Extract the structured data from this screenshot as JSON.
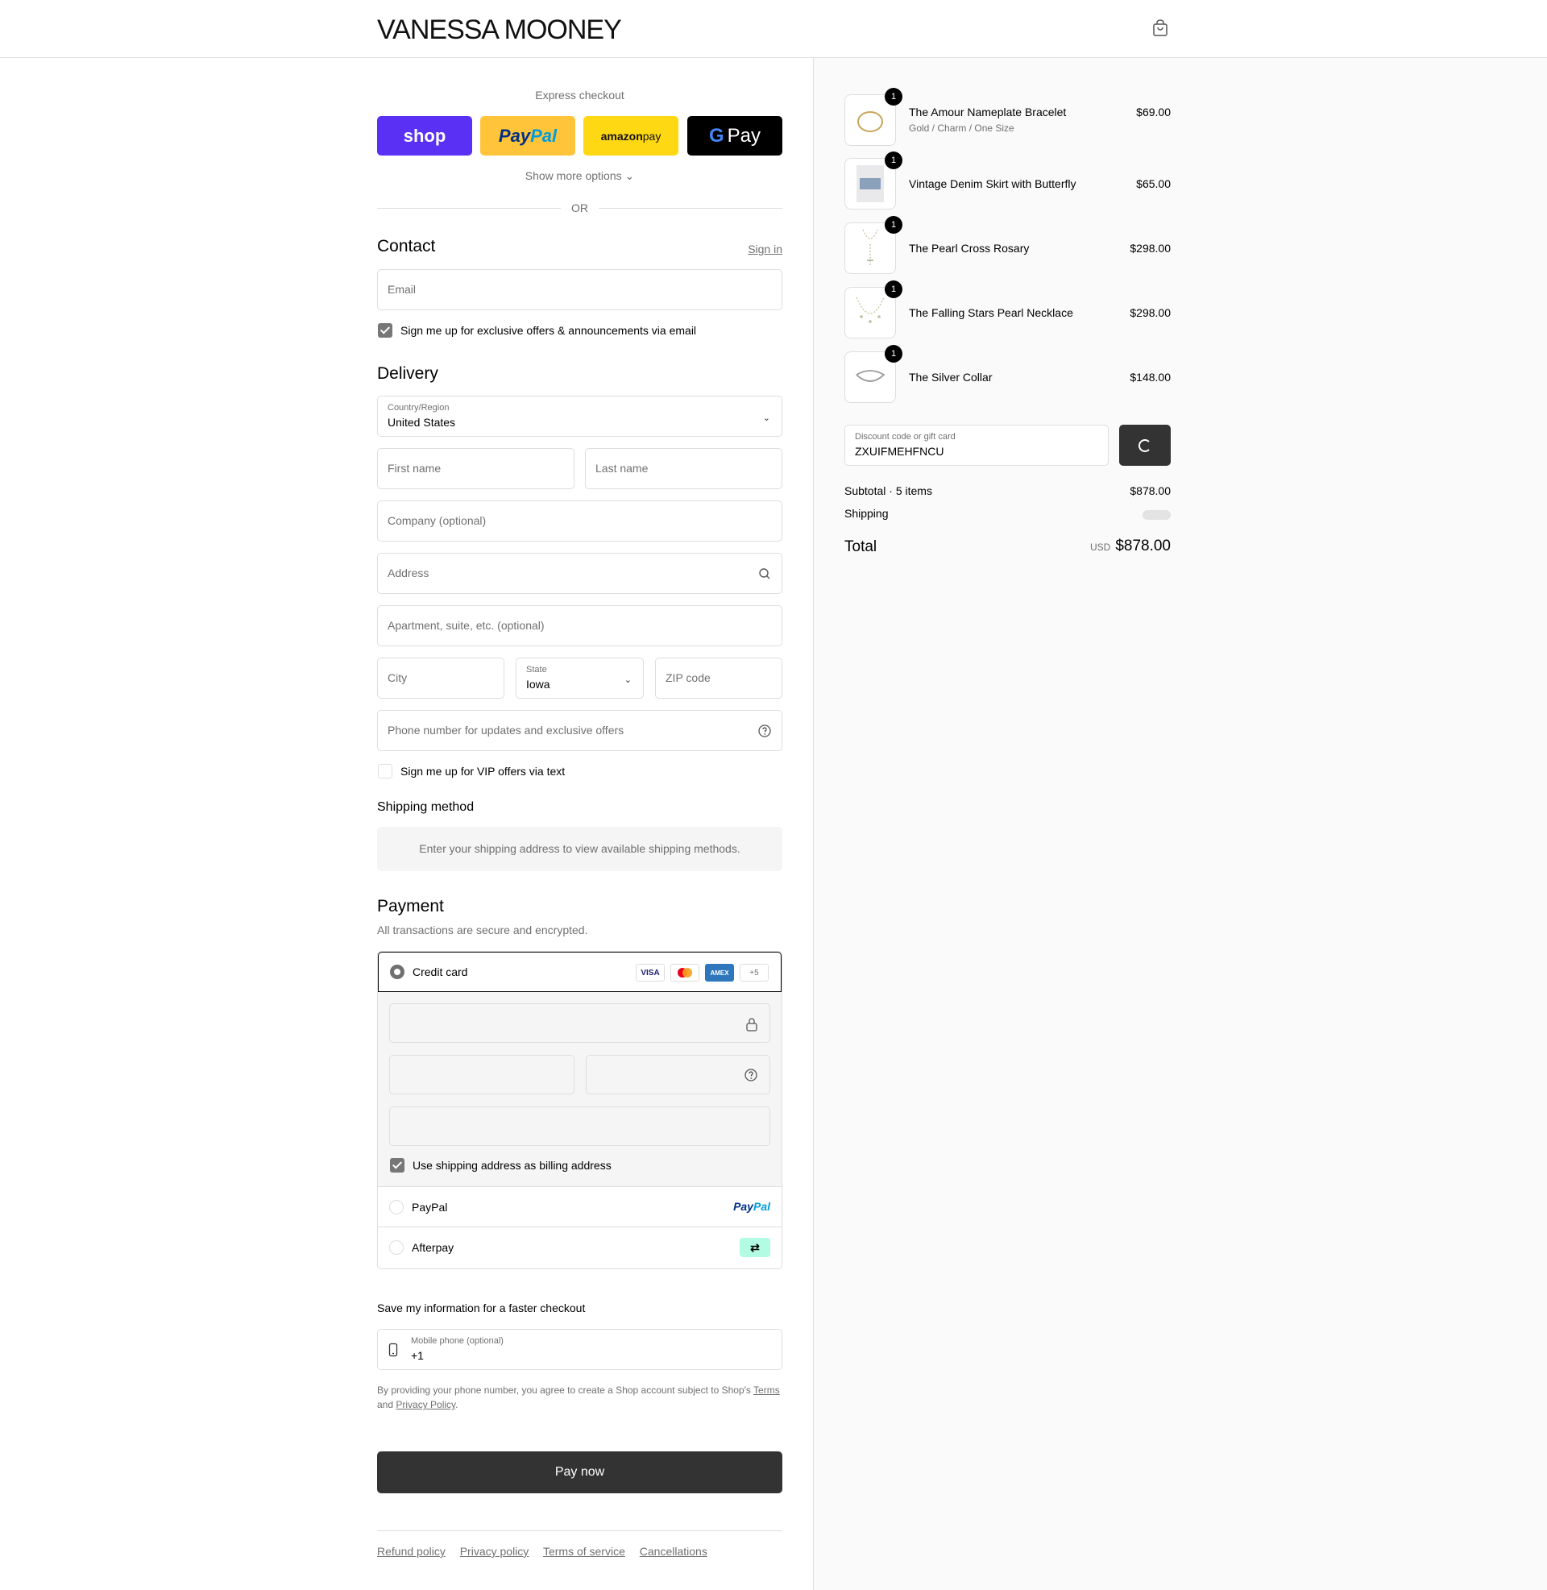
{
  "header": {
    "brand": "VANESSA MOONEY",
    "cart_icon": "shopping-bag-icon"
  },
  "express": {
    "title": "Express checkout",
    "buttons": {
      "shop": "shop",
      "paypal_a": "Pay",
      "paypal_b": "Pal",
      "amazon_a": "amazon",
      "amazon_b": " pay",
      "gpay_g": "G",
      "gpay": "Pay"
    },
    "more_options": "Show more options",
    "or": "OR"
  },
  "contact": {
    "title": "Contact",
    "sign_in": "Sign in",
    "email_placeholder": "Email",
    "newsletter_label": "Sign me up for exclusive offers & announcements via email",
    "newsletter_checked": true
  },
  "delivery": {
    "title": "Delivery",
    "country_label": "Country/Region",
    "country_value": "United States",
    "first_name": "First name",
    "last_name": "Last name",
    "company": "Company (optional)",
    "address": "Address",
    "apartment": "Apartment, suite, etc. (optional)",
    "city": "City",
    "state_label": "State",
    "state_value": "Iowa",
    "zip": "ZIP code",
    "phone": "Phone number for updates and exclusive offers",
    "vip_label": "Sign me up for VIP offers via text",
    "vip_checked": false
  },
  "shipping_method": {
    "title": "Shipping method",
    "info": "Enter your shipping address to view available shipping methods."
  },
  "payment": {
    "title": "Payment",
    "subtitle": "All transactions are secure and encrypted.",
    "credit_card": "Credit card",
    "card_brands": [
      "VISA",
      "MC",
      "AMEX",
      "+5"
    ],
    "billing_label": "Use shipping address as billing address",
    "billing_checked": true,
    "paypal": "PayPal",
    "paypal_logo_a": "Pay",
    "paypal_logo_b": "Pal",
    "afterpay": "Afterpay"
  },
  "save_info": {
    "title": "Save my information for a faster checkout",
    "mobile_label": "Mobile phone (optional)",
    "mobile_value": "+1",
    "consent_a": "By providing your phone number, you agree to create a Shop account subject to Shop's ",
    "terms": "Terms",
    "consent_b": " and ",
    "privacy": "Privacy Policy",
    "consent_c": "."
  },
  "pay_now": "Pay now",
  "footer_links": [
    "Refund policy",
    "Privacy policy",
    "Terms of service",
    "Cancellations"
  ],
  "order": {
    "items": [
      {
        "name": "The Amour Nameplate Bracelet",
        "variant": "Gold / Charm / One Size",
        "price": "$69.00",
        "qty": "1"
      },
      {
        "name": "Vintage Denim Skirt with Butterfly",
        "variant": "",
        "price": "$65.00",
        "qty": "1"
      },
      {
        "name": "The Pearl Cross Rosary",
        "variant": "",
        "price": "$298.00",
        "qty": "1"
      },
      {
        "name": "The Falling Stars Pearl Necklace",
        "variant": "",
        "price": "$298.00",
        "qty": "1"
      },
      {
        "name": "The Silver Collar",
        "variant": "",
        "price": "$148.00",
        "qty": "1"
      }
    ],
    "discount_label": "Discount code or gift card",
    "discount_value": "ZXUIFMEHFNCU",
    "subtotal_label": "Subtotal · 5 items",
    "subtotal": "$878.00",
    "shipping_label": "Shipping",
    "total_label": "Total",
    "currency": "USD",
    "total": "$878.00"
  },
  "colors": {
    "shop": "#5a31f4",
    "paypal": "#ffc439",
    "amazon": "#ffd814",
    "gpay": "#000000",
    "pay_button": "#333333",
    "afterpay": "#b2fce4"
  }
}
